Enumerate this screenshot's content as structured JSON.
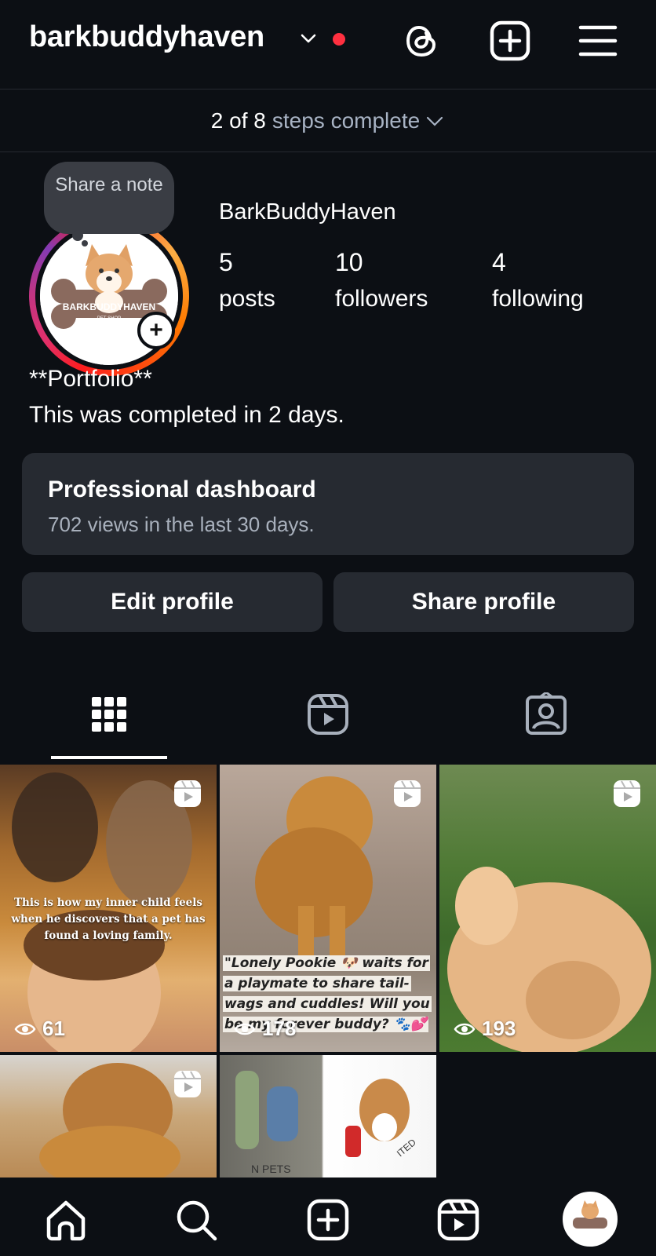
{
  "header": {
    "username": "barkbuddyhaven",
    "icons": [
      "chevron-down-icon",
      "notification-dot",
      "threads-icon",
      "create-icon",
      "menu-icon"
    ]
  },
  "steps": {
    "done": "2 of 8",
    "rest": "steps complete"
  },
  "note": {
    "text": "Share a note"
  },
  "profile": {
    "display_name": "BarkBuddyHaven",
    "avatar_text": "BARKBUDDYHAVEN",
    "avatar_subtext": "PET SHOP",
    "stats": [
      {
        "value": "5",
        "label": "posts"
      },
      {
        "value": "10",
        "label": "followers"
      },
      {
        "value": "4",
        "label": "following"
      }
    ],
    "bio_line1": "**Portfolio**",
    "bio_line2": "This was completed in 2 days."
  },
  "dashboard": {
    "title": "Professional dashboard",
    "subtitle": "702 views in the last 30 days."
  },
  "buttons": {
    "edit": "Edit profile",
    "share": "Share profile"
  },
  "tabs": [
    "grid-icon",
    "reels-icon",
    "tagged-icon"
  ],
  "posts": [
    {
      "views": "61",
      "caption": "This is how my inner child feels when he discovers that a pet has found a loving family.",
      "reel": true
    },
    {
      "views": "178",
      "caption": "\"Lonely Pookie 🐶 waits for a playmate to share tail-wags and cuddles! Will you be my forever buddy? 🐾💕",
      "reel": true
    },
    {
      "views": "193",
      "caption": "",
      "reel": true
    },
    {
      "views": "",
      "caption": "",
      "reel": true
    },
    {
      "views": "",
      "caption": "",
      "reel": false,
      "stamp": "N PETS",
      "stamp2": "ITED"
    }
  ],
  "bottom_nav": [
    "home-icon",
    "search-icon",
    "create-icon",
    "reels-icon",
    "profile-avatar"
  ],
  "colors": {
    "background": "#0c0f14",
    "card": "#262a31",
    "notification": "#ff3040"
  }
}
